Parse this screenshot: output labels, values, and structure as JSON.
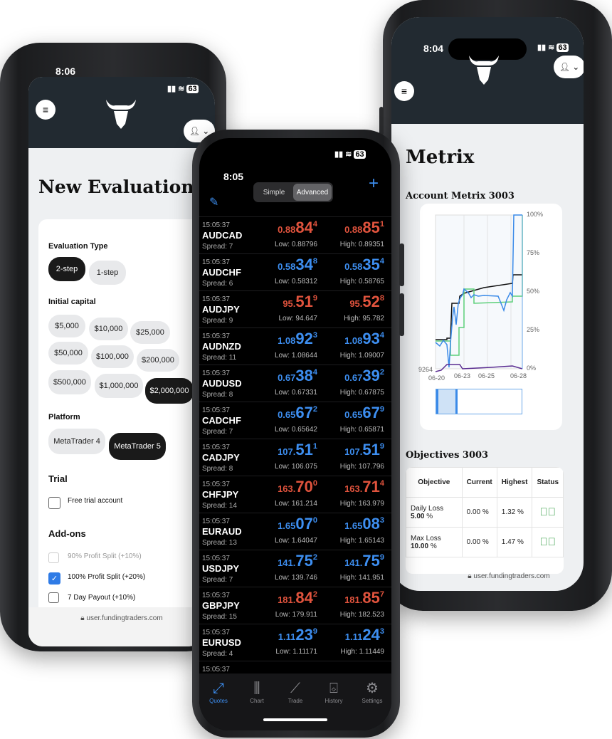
{
  "left_phone": {
    "time": "8:06",
    "battery": "63",
    "title": "New Evaluation",
    "evaluation_type": {
      "label": "Evaluation Type",
      "options": [
        "2-step",
        "1-step"
      ],
      "selected": "2-step"
    },
    "initial_capital": {
      "label": "Initial capital",
      "options": [
        "$5,000",
        "$10,000",
        "$25,000",
        "$50,000",
        "$100,000",
        "$200,000",
        "$500,000",
        "$1,000,000",
        "$2,000,000"
      ],
      "selected": "$2,000,000"
    },
    "platform": {
      "label": "Platform",
      "options": [
        "MetaTrader 4",
        "MetaTrader 5"
      ],
      "selected": "MetaTrader 5"
    },
    "trial": {
      "label": "Trial",
      "checkbox": "Free trial account",
      "checked": false
    },
    "addons": {
      "label": "Add-ons",
      "items": [
        {
          "label": "90% Profit Split (+10%)",
          "checked": false,
          "disabled": true
        },
        {
          "label": "100% Profit Split (+20%)",
          "checked": true,
          "disabled": false
        },
        {
          "label": "7 Day Payout (+10%)",
          "checked": false,
          "disabled": false
        }
      ]
    },
    "url": "user.fundingtraders.com"
  },
  "center_phone": {
    "time": "8:05",
    "battery": "63",
    "segments": [
      "Simple",
      "Advanced"
    ],
    "selected_segment": "Advanced",
    "colors": {
      "down": "#e0533d",
      "up": "#3d8ef0"
    },
    "quotes": [
      {
        "time": "15:05:37",
        "symbol": "AUDCAD",
        "spread": "Spread: 7",
        "dir": "down",
        "bid": [
          "0.88",
          "84",
          "4"
        ],
        "ask": [
          "0.88",
          "85",
          "1"
        ],
        "low": "Low: 0.88796",
        "high": "High: 0.89351"
      },
      {
        "time": "15:05:37",
        "symbol": "AUDCHF",
        "spread": "Spread: 6",
        "dir": "up",
        "bid": [
          "0.58",
          "34",
          "8"
        ],
        "ask": [
          "0.58",
          "35",
          "4"
        ],
        "low": "Low: 0.58312",
        "high": "High: 0.58765"
      },
      {
        "time": "15:05:37",
        "symbol": "AUDJPY",
        "spread": "Spread: 9",
        "dir": "down",
        "bid": [
          "95.",
          "51",
          "9"
        ],
        "ask": [
          "95.",
          "52",
          "8"
        ],
        "low": "Low: 94.647",
        "high": "High: 95.782"
      },
      {
        "time": "15:05:37",
        "symbol": "AUDNZD",
        "spread": "Spread: 11",
        "dir": "up",
        "bid": [
          "1.08",
          "92",
          "3"
        ],
        "ask": [
          "1.08",
          "93",
          "4"
        ],
        "low": "Low: 1.08644",
        "high": "High: 1.09007"
      },
      {
        "time": "15:05:37",
        "symbol": "AUDUSD",
        "spread": "Spread: 8",
        "dir": "up",
        "bid": [
          "0.67",
          "38",
          "4"
        ],
        "ask": [
          "0.67",
          "39",
          "2"
        ],
        "low": "Low: 0.67331",
        "high": "High: 0.67875"
      },
      {
        "time": "15:05:37",
        "symbol": "CADCHF",
        "spread": "Spread: 7",
        "dir": "up",
        "bid": [
          "0.65",
          "67",
          "2"
        ],
        "ask": [
          "0.65",
          "67",
          "9"
        ],
        "low": "Low: 0.65642",
        "high": "High: 0.65871"
      },
      {
        "time": "15:05:37",
        "symbol": "CADJPY",
        "spread": "Spread: 8",
        "dir": "up",
        "bid": [
          "107.",
          "51",
          "1"
        ],
        "ask": [
          "107.",
          "51",
          "9"
        ],
        "low": "Low: 106.075",
        "high": "High: 107.796"
      },
      {
        "time": "15:05:37",
        "symbol": "CHFJPY",
        "spread": "Spread: 14",
        "dir": "down",
        "bid": [
          "163.",
          "70",
          "0"
        ],
        "ask": [
          "163.",
          "71",
          "4"
        ],
        "low": "Low: 161.214",
        "high": "High: 163.979"
      },
      {
        "time": "15:05:37",
        "symbol": "EURAUD",
        "spread": "Spread: 13",
        "dir": "up",
        "bid": [
          "1.65",
          "07",
          "0"
        ],
        "ask": [
          "1.65",
          "08",
          "3"
        ],
        "low": "Low: 1.64047",
        "high": "High: 1.65143"
      },
      {
        "time": "15:05:37",
        "symbol": "USDJPY",
        "spread": "Spread: 7",
        "dir": "up",
        "bid": [
          "141.",
          "75",
          "2"
        ],
        "ask": [
          "141.",
          "75",
          "9"
        ],
        "low": "Low: 139.746",
        "high": "High: 141.951"
      },
      {
        "time": "15:05:37",
        "symbol": "GBPJPY",
        "spread": "Spread: 15",
        "dir": "down",
        "bid": [
          "181.",
          "84",
          "2"
        ],
        "ask": [
          "181.",
          "85",
          "7"
        ],
        "low": "Low: 179.911",
        "high": "High: 182.523"
      },
      {
        "time": "15:05:37",
        "symbol": "EURUSD",
        "spread": "Spread: 4",
        "dir": "up",
        "bid": [
          "1.11",
          "23",
          "9"
        ],
        "ask": [
          "1.11",
          "24",
          "3"
        ],
        "low": "Low: 1.11171",
        "high": "High: 1.11449"
      },
      {
        "time": "15:05:37"
      }
    ],
    "tabs": [
      {
        "label": "Quotes",
        "icon": "quotes-arrows-icon",
        "active": true
      },
      {
        "label": "Chart",
        "icon": "candlestick-icon",
        "active": false
      },
      {
        "label": "Trade",
        "icon": "trade-trend-icon",
        "active": false
      },
      {
        "label": "History",
        "icon": "inbox-tray-icon",
        "active": false
      },
      {
        "label": "Settings",
        "icon": "gear-icon",
        "active": false
      }
    ]
  },
  "right_phone": {
    "time": "8:04",
    "battery": "63",
    "title": "Metrix",
    "chart_title": "Account Metrix 3003",
    "y_ticks": [
      "100%",
      "75%",
      "50%",
      "25%",
      "0%"
    ],
    "x_ticks": [
      "06-20",
      "06-23",
      "06-25",
      "06-28"
    ],
    "y_left_label": "9264",
    "objectives_title": "Objectives 3003",
    "table": {
      "headers": [
        "Objective",
        "Current",
        "Highest",
        "Status"
      ],
      "rows": [
        {
          "objective": "Daily Loss",
          "value": "5.00",
          "unit": "%",
          "current": "0.00 %",
          "highest": "1.32 %",
          "status": "passed"
        },
        {
          "objective": "Max Loss",
          "value": "10.00",
          "unit": "%",
          "current": "0.00 %",
          "highest": "1.47 %",
          "status": "passed"
        }
      ]
    },
    "url": "user.fundingtraders.com"
  }
}
